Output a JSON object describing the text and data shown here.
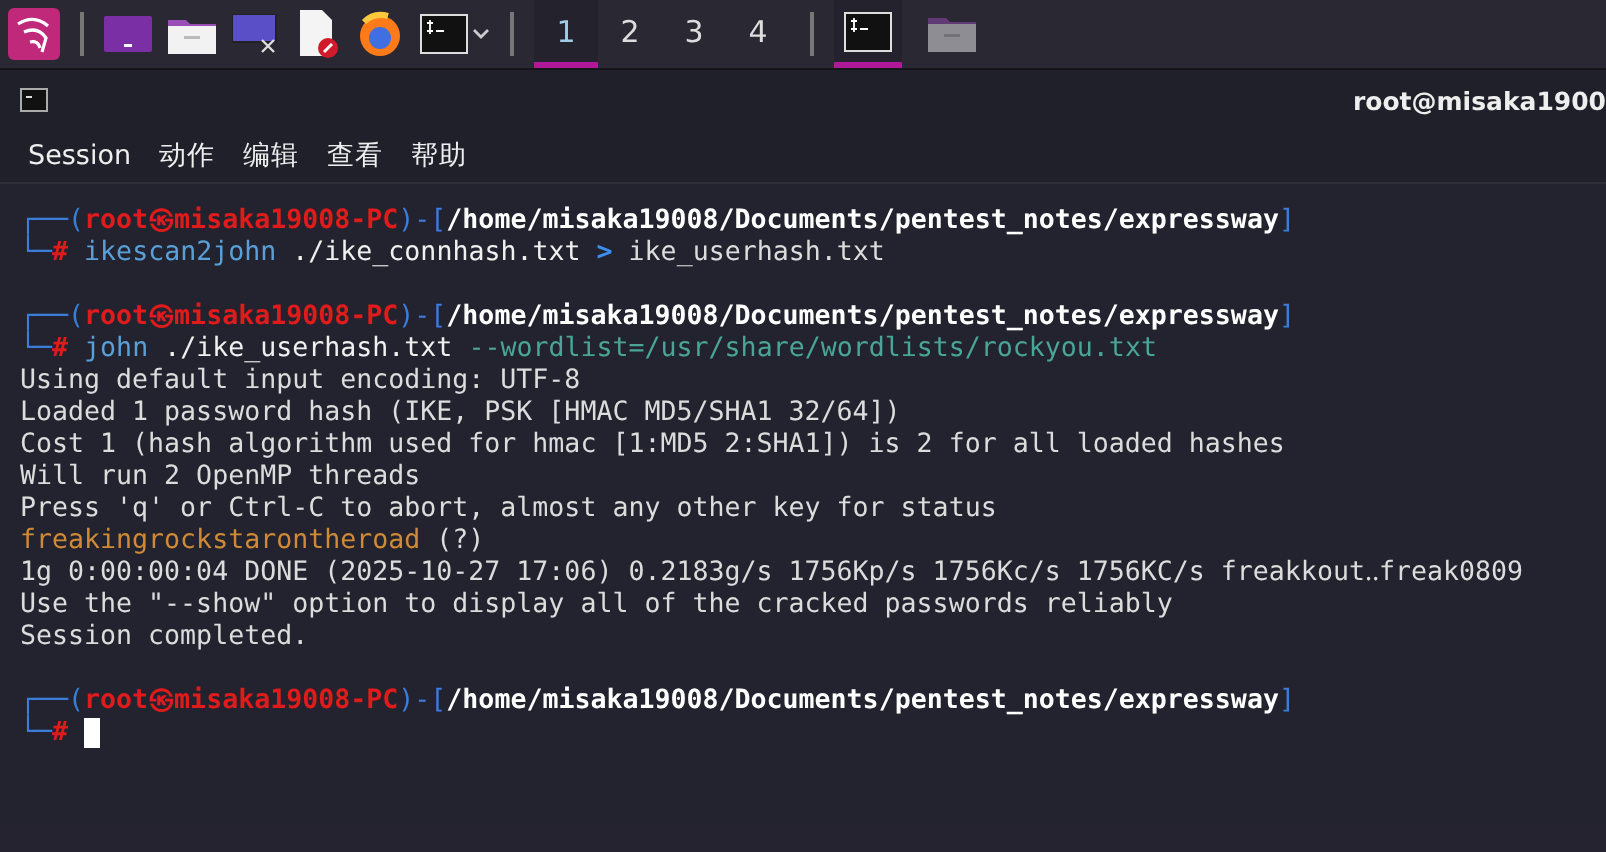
{
  "taskbar": {
    "launchers": [
      {
        "kind": "menu"
      },
      {
        "kind": "terminal-tab"
      },
      {
        "kind": "folder"
      },
      {
        "kind": "monitor"
      },
      {
        "kind": "editor"
      },
      {
        "kind": "browser"
      },
      {
        "kind": "terminal"
      }
    ],
    "workspaces": [
      {
        "label": "1",
        "selected": true
      },
      {
        "label": "2",
        "selected": false
      },
      {
        "label": "3",
        "selected": false
      },
      {
        "label": "4",
        "selected": false
      }
    ],
    "tasks": [
      {
        "kind": "terminal",
        "active": true
      },
      {
        "kind": "folder",
        "active": false
      }
    ]
  },
  "window": {
    "title": "root@misaka1900"
  },
  "menu": [
    "Session",
    "动作",
    "编辑",
    "查看",
    "帮助"
  ],
  "terminal": {
    "lines": [
      {
        "kind": "prompt",
        "frame": "┌──(",
        "user": "root㉿misaka19008-PC",
        "sep": ")-[",
        "path": "/home/misaka19008/Documents/pentest_notes/expressway",
        "close": "]"
      },
      {
        "kind": "command",
        "frame": "└─",
        "symbol": "#",
        "tokens": [
          {
            "kind": "program",
            "text": "ikescan2john"
          },
          {
            "kind": "arg",
            "text": "./ike_connhash.txt"
          },
          {
            "kind": "redirect",
            "text": ">"
          },
          {
            "kind": "plain",
            "text": "ike_userhash.txt"
          }
        ]
      },
      {
        "kind": "blank"
      },
      {
        "kind": "prompt",
        "frame": "┌──(",
        "user": "root㉿misaka19008-PC",
        "sep": ")-[",
        "path": "/home/misaka19008/Documents/pentest_notes/expressway",
        "close": "]"
      },
      {
        "kind": "command",
        "frame": "└─",
        "symbol": "#",
        "tokens": [
          {
            "kind": "program",
            "text": "john"
          },
          {
            "kind": "arg",
            "text": "./ike_userhash.txt"
          },
          {
            "kind": "option",
            "text": "--wordlist=/usr/share/wordlists/rockyou.txt"
          }
        ]
      },
      {
        "kind": "output",
        "text": "Using default input encoding: UTF-8"
      },
      {
        "kind": "output",
        "text": "Loaded 1 password hash (IKE, PSK [HMAC MD5/SHA1 32/64])"
      },
      {
        "kind": "output",
        "text": "Cost 1 (hash algorithm used for hmac [1:MD5 2:SHA1]) is 2 for all loaded hashes"
      },
      {
        "kind": "output",
        "text": "Will run 2 OpenMP threads"
      },
      {
        "kind": "output",
        "text": "Press 'q' or Ctrl-C to abort, almost any other key for status"
      },
      {
        "kind": "found",
        "password": "freakingrockstarontheroad",
        "note": "(?)"
      },
      {
        "kind": "output",
        "text": "1g 0:00:00:04 DONE (2025-10-27 17:06) 0.2183g/s 1756Kp/s 1756Kc/s 1756KC/s freakkout‥freak0809"
      },
      {
        "kind": "output",
        "text": "Use the \"--show\" option to display all of the cracked passwords reliably"
      },
      {
        "kind": "output",
        "text": "Session completed."
      },
      {
        "kind": "blank"
      },
      {
        "kind": "prompt",
        "frame": "┌──(",
        "user": "root㉿misaka19008-PC",
        "sep": ")-[",
        "path": "/home/misaka19008/Documents/pentest_notes/expressway",
        "close": "]"
      },
      {
        "kind": "command",
        "frame": "└─",
        "symbol": "#",
        "cursor": true
      }
    ]
  }
}
